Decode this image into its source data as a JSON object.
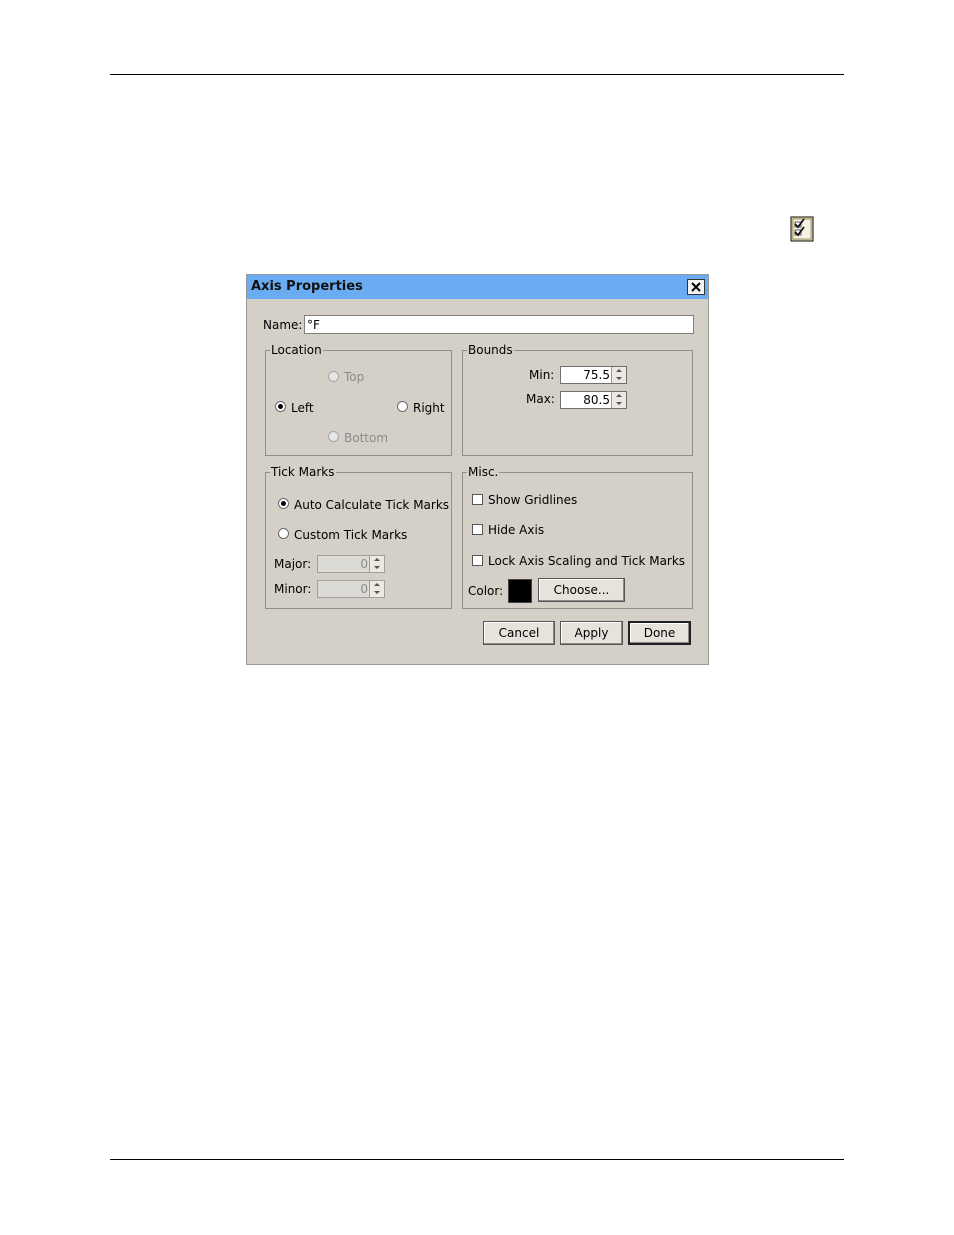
{
  "dialog": {
    "title": "Axis Properties",
    "name_label": "Name:",
    "name_value": "°F"
  },
  "location": {
    "legend": "Location",
    "top": "Top",
    "left": "Left",
    "right": "Right",
    "bottom": "Bottom",
    "selected": "Left"
  },
  "bounds": {
    "legend": "Bounds",
    "min_label": "Min:",
    "min_value": "75.5",
    "max_label": "Max:",
    "max_value": "80.5"
  },
  "tick_marks": {
    "legend": "Tick Marks",
    "auto_label": "Auto Calculate Tick Marks",
    "custom_label": "Custom Tick Marks",
    "selected": "Auto Calculate Tick Marks",
    "major_label": "Major:",
    "major_value": "0",
    "minor_label": "Minor:",
    "minor_value": "0"
  },
  "misc": {
    "legend": "Misc.",
    "show_gridlines": "Show Gridlines",
    "hide_axis": "Hide Axis",
    "lock_axis": "Lock Axis Scaling and Tick Marks",
    "color_label": "Color:",
    "color_value": "#000000",
    "choose_button": "Choose..."
  },
  "buttons": {
    "cancel": "Cancel",
    "apply": "Apply",
    "done": "Done"
  },
  "colors": {
    "titlebar": "#69acf2",
    "dialog_bg": "#d4d0c8"
  }
}
